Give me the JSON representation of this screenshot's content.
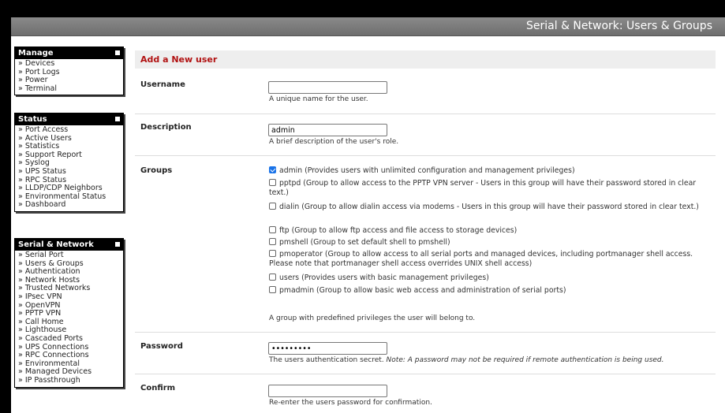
{
  "header": {
    "title": "Serial & Network: Users & Groups"
  },
  "sidebar": {
    "manage": {
      "title": "Manage",
      "items": [
        "» Devices",
        "» Port Logs",
        "» Power",
        "» Terminal"
      ]
    },
    "status": {
      "title": "Status",
      "items": [
        "» Port Access",
        "» Active Users",
        "» Statistics",
        "» Support Report",
        "» Syslog",
        "» UPS Status",
        "» RPC Status",
        "» LLDP/CDP Neighbors",
        "» Environmental Status",
        "» Dashboard"
      ]
    },
    "serial_network": {
      "title": "Serial & Network",
      "items": [
        "» Serial Port",
        "» Users & Groups",
        "» Authentication",
        "» Network Hosts",
        "» Trusted Networks",
        "» IPsec VPN",
        "» OpenVPN",
        "» PPTP VPN",
        "» Call Home",
        "» Lighthouse",
        "» Cascaded Ports",
        "» UPS Connections",
        "» RPC Connections",
        "» Environmental",
        "» Managed Devices",
        "» IP Passthrough"
      ]
    }
  },
  "form": {
    "section_title": "Add a New user",
    "username": {
      "label": "Username",
      "value": "",
      "hint": "A unique name for the user."
    },
    "description": {
      "label": "Description",
      "value": "admin",
      "hint": "A brief description of the user's role."
    },
    "groups": {
      "label": "Groups",
      "options": [
        {
          "checked": true,
          "text": "admin (Provides users with unlimited configuration and management privileges)"
        },
        {
          "checked": false,
          "text": "pptpd (Group to allow access to the PPTP VPN server - Users in this group will have their password stored in clear text.)"
        },
        {
          "checked": false,
          "text": "dialin (Group to allow dialin access via modems - Users in this group will have their password stored in clear text.)"
        },
        {
          "checked": false,
          "text": "ftp (Group to allow ftp access and file access to storage devices)"
        },
        {
          "checked": false,
          "text": "pmshell (Group to set default shell to pmshell)"
        },
        {
          "checked": false,
          "text": "pmoperator (Group to allow access to all serial ports and managed devices, including portmanager shell access. Please note that portmanager shell access overrides UNIX shell access)"
        },
        {
          "checked": false,
          "text": "users (Provides users with basic management privileges)"
        },
        {
          "checked": false,
          "text": "pmadmin (Group to allow basic web access and administration of serial ports)"
        }
      ],
      "hint": "A group with predefined privileges the user will belong to."
    },
    "password": {
      "label": "Password",
      "value": "•••••••••",
      "hint": "The users authentication secret.",
      "note": "Note: A password may not be required if remote authentication is being used."
    },
    "confirm": {
      "label": "Confirm",
      "value": "",
      "hint": "Re-enter the users password for confirmation."
    }
  }
}
